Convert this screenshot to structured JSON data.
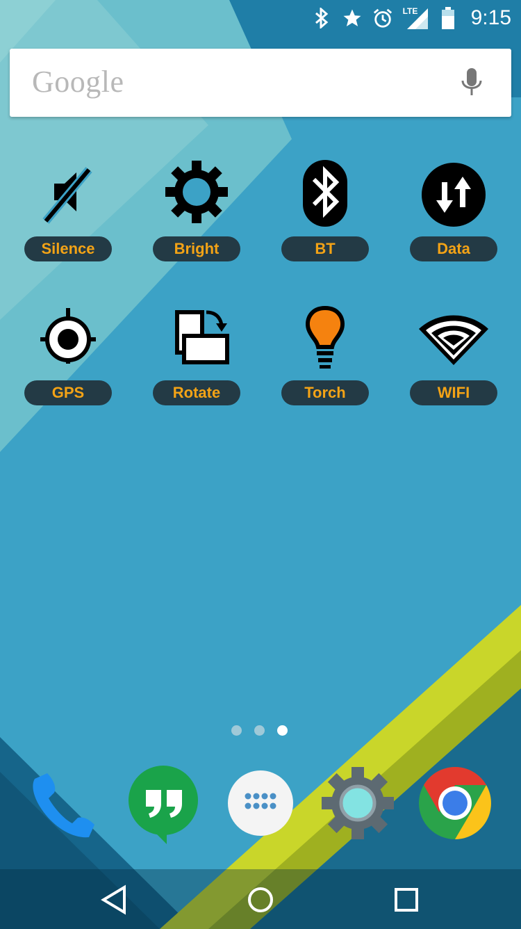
{
  "status_bar": {
    "icons": [
      "bluetooth-icon",
      "star-icon",
      "alarm-icon",
      "lte-signal-icon",
      "battery-icon"
    ],
    "network_label": "LTE",
    "time": "9:15"
  },
  "search": {
    "logo_text": "Google",
    "voice_icon": "mic-icon"
  },
  "toggles": [
    {
      "label": "Silence",
      "icon": "silence-icon"
    },
    {
      "label": "Bright",
      "icon": "brightness-icon"
    },
    {
      "label": "BT",
      "icon": "bluetooth-icon"
    },
    {
      "label": "Data",
      "icon": "data-icon"
    },
    {
      "label": "GPS",
      "icon": "gps-icon"
    },
    {
      "label": "Rotate",
      "icon": "rotate-icon"
    },
    {
      "label": "Torch",
      "icon": "torch-icon"
    },
    {
      "label": "WIFI",
      "icon": "wifi-icon"
    }
  ],
  "page_indicator": {
    "count": 3,
    "active": 3
  },
  "dock": [
    {
      "name": "phone-app-icon"
    },
    {
      "name": "hangouts-app-icon"
    },
    {
      "name": "app-drawer-icon"
    },
    {
      "name": "settings-app-icon"
    },
    {
      "name": "chrome-app-icon"
    }
  ],
  "nav": [
    "back-icon",
    "home-icon",
    "recents-icon"
  ],
  "colors": {
    "label_bg": "#233a45",
    "label_text": "#f3a316",
    "wallpaper_main": "#3aa0c4",
    "accent_yellow": "#c8d62a"
  }
}
